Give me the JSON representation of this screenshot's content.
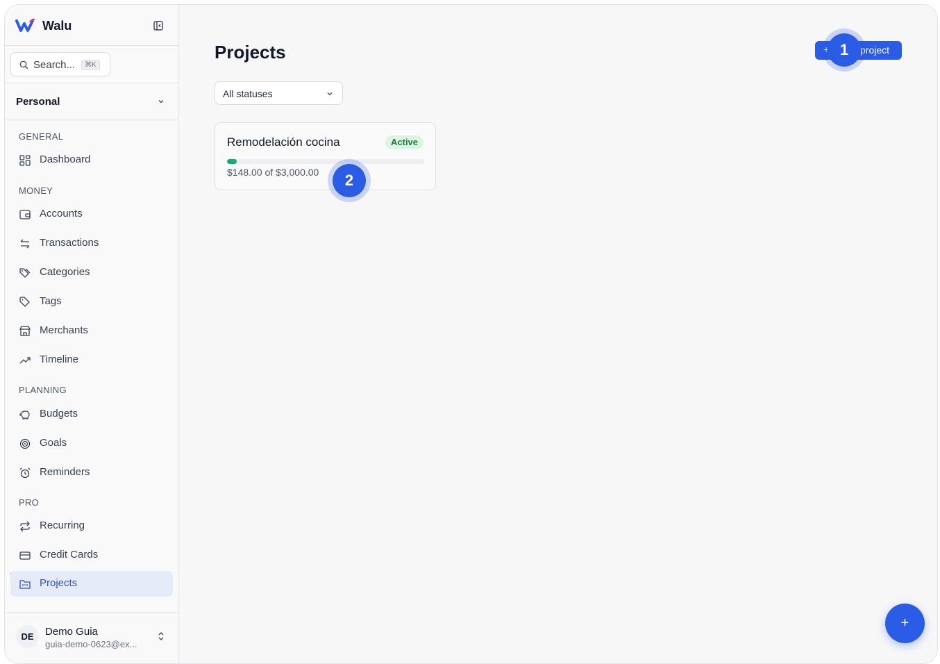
{
  "app": {
    "name": "Walu"
  },
  "search": {
    "placeholder": "Search...",
    "shortcut": "⌘K"
  },
  "workspace": {
    "selected": "Personal"
  },
  "sidebar": {
    "sections": {
      "general": "GENERAL",
      "money": "MONEY",
      "planning": "PLANNING",
      "pro": "PRO"
    },
    "items": {
      "dashboard": "Dashboard",
      "accounts": "Accounts",
      "transactions": "Transactions",
      "categories": "Categories",
      "tags": "Tags",
      "merchants": "Merchants",
      "timeline": "Timeline",
      "budgets": "Budgets",
      "goals": "Goals",
      "reminders": "Reminders",
      "recurring": "Recurring",
      "credit_cards": "Credit Cards",
      "projects": "Projects"
    },
    "active": "projects"
  },
  "user": {
    "initials": "DE",
    "name": "Demo Guia",
    "email": "guia-demo-0623@ex..."
  },
  "main": {
    "title": "Projects",
    "new_button": {
      "icon": "+",
      "label": "project"
    },
    "filter": {
      "value": "All statuses"
    },
    "projects": [
      {
        "name": "Remodelación cocina",
        "status": "Active",
        "spent": "$148.00",
        "budget": "$3,000.00",
        "amount_text": "$148.00 of $3,000.00",
        "progress": 0.0493
      }
    ]
  },
  "steps": [
    "1",
    "2"
  ],
  "fab": {
    "icon": "+"
  },
  "colors": {
    "accent": "#2b5ce6",
    "active_badge": "#dcf5e3",
    "progress": "#10b070"
  }
}
